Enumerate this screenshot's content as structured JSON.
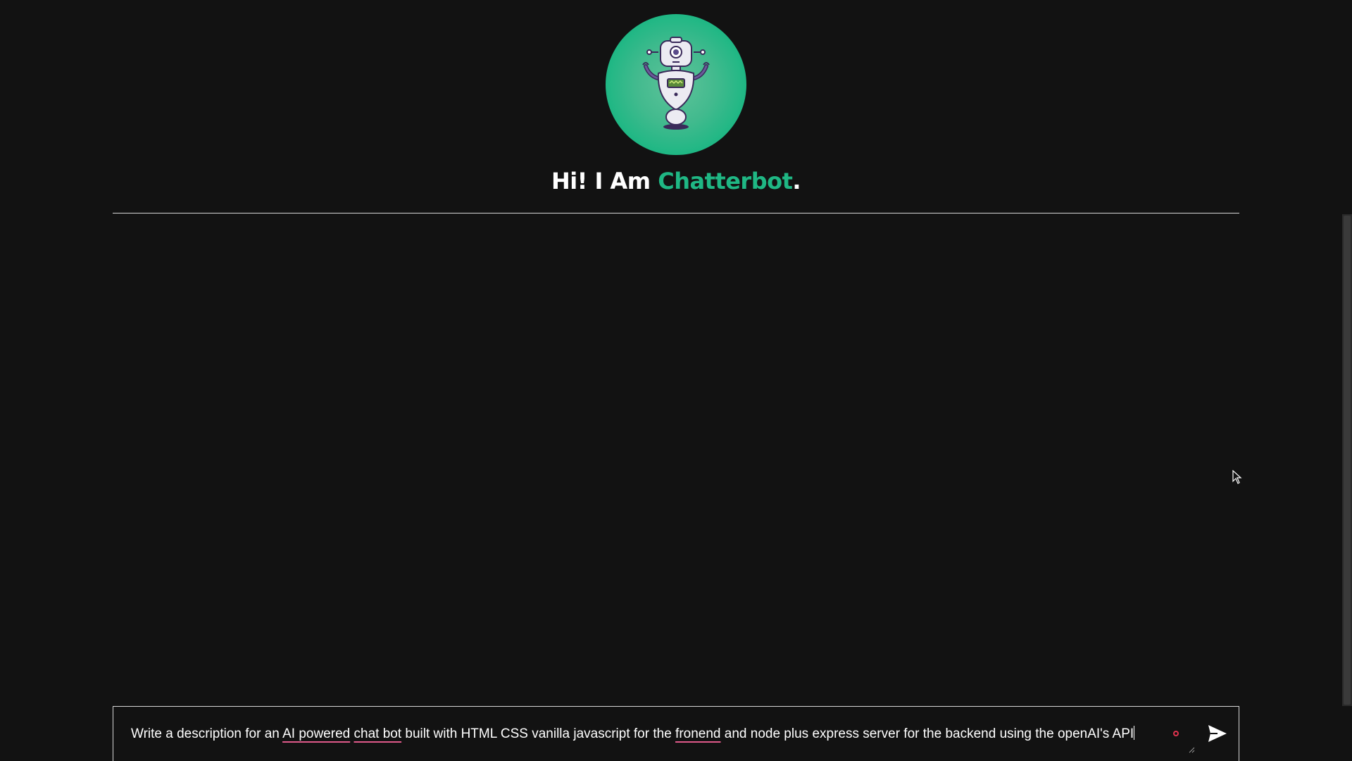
{
  "header": {
    "avatar_icon": "robot-icon",
    "title_prefix": "Hi! I Am ",
    "title_brand": "Chatterbot",
    "title_suffix": "."
  },
  "composer": {
    "segments": [
      {
        "text": "Write a description for an ",
        "typo": false
      },
      {
        "text": "AI powered",
        "typo": true
      },
      {
        "text": " ",
        "typo": false
      },
      {
        "text": "chat bot",
        "typo": true
      },
      {
        "text": " built with HTML CSS vanilla javascript for the ",
        "typo": false
      },
      {
        "text": "fronend",
        "typo": true
      },
      {
        "text": " and node plus express server for the backend using the openAI's API",
        "typo": false
      }
    ],
    "send_icon": "send-icon",
    "record_icon": "record-dot-icon"
  },
  "colors": {
    "background": "#121212",
    "brand": "#1fb784",
    "spellcheck_underline": "#e05a8a"
  }
}
